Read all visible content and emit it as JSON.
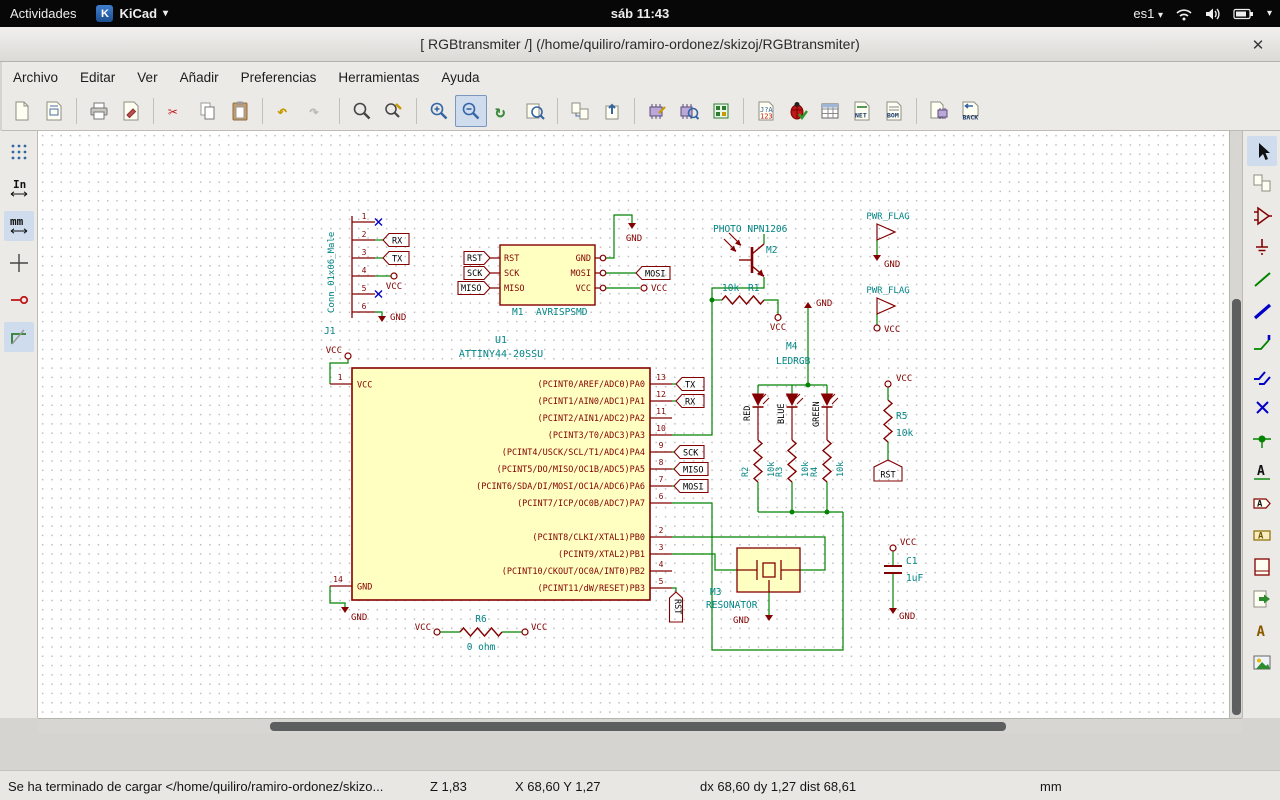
{
  "topbar": {
    "activities": "Actividades",
    "app": "KiCad",
    "clock": "sáb 11:43",
    "layout": "es1",
    "caret": "▾"
  },
  "window": {
    "title": "[ RGBtransmiter /] (/home/quiliro/ramiro-ordonez/skizoj/RGBtransmiter)",
    "close": "✕"
  },
  "menus": {
    "items": [
      "Archivo",
      "Editar",
      "Ver",
      "Añadir",
      "Preferencias",
      "Herramientas",
      "Ayuda"
    ]
  },
  "toolbar": {
    "annotate_text": "123",
    "net_text": "NET",
    "bom_text": "BOM",
    "back_text": "BACK"
  },
  "left_toolbar": {
    "inches": "In",
    "mm": "mm"
  },
  "right_toolbar": {
    "label_a": "A"
  },
  "statusbar": {
    "message": "Se ha terminado de cargar </home/quiliro/ramiro-ordonez/skizo...",
    "zoom": "Z 1,83",
    "position": "X 68,60 Y 1,27",
    "delta": "dx 68,60 dy 1,27 dist 68,61",
    "units": "mm"
  },
  "schematic": {
    "power": {
      "vcc": "VCC",
      "gnd": "GND",
      "pwr_flag": "PWR_FLAG"
    },
    "nets": {
      "rx": "RX",
      "tx": "TX",
      "sck": "SCK",
      "miso": "MISO",
      "mosi": "MOSI",
      "rst": "RST"
    },
    "j1": {
      "ref": "J1",
      "value": "Conn_01x06_Male",
      "pins": [
        "1",
        "2",
        "3",
        "4",
        "5",
        "6"
      ]
    },
    "m1": {
      "ref": "M1",
      "value": "AVRISPSMD",
      "left_pins": [
        "RST",
        "SCK",
        "MISO"
      ],
      "right_pins": [
        "GND",
        "MOSI",
        "VCC"
      ]
    },
    "u1": {
      "ref": "U1",
      "value": "ATTINY44-20SSU",
      "pin1": "1",
      "pin14": "14",
      "vcc": "VCC",
      "gnd": "GND",
      "right_pins": [
        {
          "num": "13",
          "name": "(PCINT0/AREF/ADC0)PA0"
        },
        {
          "num": "12",
          "name": "(PCINT1/AIN0/ADC1)PA1"
        },
        {
          "num": "11",
          "name": "(PCINT2/AIN1/ADC2)PA2"
        },
        {
          "num": "10",
          "name": "(PCINT3/T0/ADC3)PA3"
        },
        {
          "num": "9",
          "name": "(PCINT4/USCK/SCL/T1/ADC4)PA4"
        },
        {
          "num": "8",
          "name": "(PCINT5/DO/MISO/OC1B/ADC5)PA5"
        },
        {
          "num": "7",
          "name": "(PCINT6/SDA/DI/MOSI/OC1A/ADC6)PA6"
        },
        {
          "num": "6",
          "name": "(PCINT7/ICP/OC0B/ADC7)PA7"
        },
        {
          "num": "2",
          "name": "(PCINT8/CLKI/XTAL1)PB0"
        },
        {
          "num": "3",
          "name": "(PCINT9/XTAL2)PB1"
        },
        {
          "num": "4",
          "name": "(PCINT10/CKOUT/OC0A/INT0)PB2"
        },
        {
          "num": "5",
          "name": "(PCINT11/dW/RESET)PB3"
        }
      ]
    },
    "m2": {
      "ref": "M2",
      "value": "PHOTO NPN1206"
    },
    "r1": {
      "ref": "R1",
      "value": "10k"
    },
    "m4": {
      "ref": "M4",
      "value": "LEDRGB",
      "leds": [
        "RED",
        "BLUE",
        "GREEN"
      ]
    },
    "r2": {
      "ref": "R2",
      "value": "10k"
    },
    "r3": {
      "ref": "R3",
      "value": "10k"
    },
    "r4": {
      "ref": "R4",
      "value": "10k"
    },
    "m3": {
      "ref": "M3",
      "value": "RESONATOR"
    },
    "r5": {
      "ref": "R5",
      "value": "10k"
    },
    "r6": {
      "ref": "R6",
      "value": "0 ohm"
    },
    "c1": {
      "ref": "C1",
      "value": "1uF"
    }
  }
}
